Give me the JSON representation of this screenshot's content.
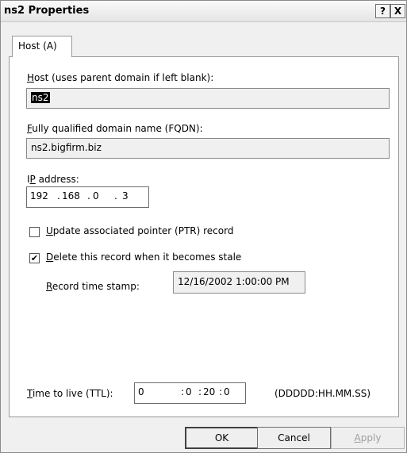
{
  "window": {
    "title": "ns2 Properties",
    "help_glyph": "?",
    "close_glyph": "X"
  },
  "tabs": [
    {
      "label": "Host (A)"
    }
  ],
  "host": {
    "label_accel": "H",
    "label_rest": "ost (uses parent domain if left blank):",
    "value": "ns2"
  },
  "fqdn": {
    "label_accel": "F",
    "label_rest": "ully qualified domain name (FQDN):",
    "value": "ns2.bigfirm.biz"
  },
  "ip": {
    "label_pre": "I",
    "label_accel": "P",
    "label_rest": " address:",
    "octets": [
      "192",
      "168",
      "0",
      "3"
    ],
    "separator": "."
  },
  "ptr_checkbox": {
    "label_accel": "U",
    "label_rest": "pdate associated pointer (PTR) record",
    "checked": false
  },
  "stale_checkbox": {
    "label_accel": "D",
    "label_rest": "elete this record when it becomes stale",
    "checked": true
  },
  "timestamp": {
    "label_accel": "R",
    "label_rest": "ecord time stamp:",
    "value": "12/16/2002 1:00:00 PM"
  },
  "ttl": {
    "label_accel": "T",
    "label_rest": "ime to live (TTL):",
    "parts": [
      "0",
      "0",
      "20",
      "0"
    ],
    "separator": ":",
    "format_hint": "(DDDDD:HH.MM.SS)"
  },
  "buttons": {
    "ok": "OK",
    "cancel": "Cancel",
    "apply_accel": "A",
    "apply_rest": "pply"
  }
}
